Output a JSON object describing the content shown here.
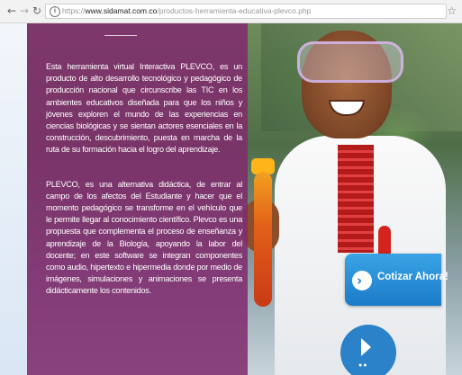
{
  "browser": {
    "back_icon": "back-arrow-icon",
    "forward_icon": "forward-arrow-icon",
    "reload_icon": "reload-icon",
    "url_prefix": "https://",
    "url_domain": "www.sidamat.com.co",
    "url_path": "/productos-herramienta-educativa-plevco.php",
    "bookmark_icon": "star-icon"
  },
  "hero": {
    "paragraphs": [
      "Esta herramienta virtual Interactiva PLEVCO, es un producto de alto desarrollo tecnológico y pedagógico de producción nacional que circunscribe las TIC en los ambientes educativos diseñada para que los niños y jóvenes exploren el mundo de las experiencias en ciencias biológicas y se sientan actores esenciales en la construcción, descubrimiento, puesta en marcha de la ruta de su formación hacia el logro del aprendizaje.",
      "PLEVCO, es una alternativa didáctica, de entrar al campo de los afectos del Estudiante y hacer que el momento pedagógico se transforme en el vehículo que le permite llegar al conocimiento científico. Plevco es una propuesta que complementa el proceso de enseñanza y aprendizaje de la Biología, apoyando la labor del docente; en este software se integran componentes como audio, hipertexto e hipermedia donde por medio de imágenes, simulaciones y animaciones se presenta didácticamente los contenidos."
    ]
  },
  "cta": {
    "label": "Cotizar Ahora!",
    "icon": "chevron-right-icon",
    "color": "#1b7bc9"
  },
  "overlay_color": "#802a6e"
}
